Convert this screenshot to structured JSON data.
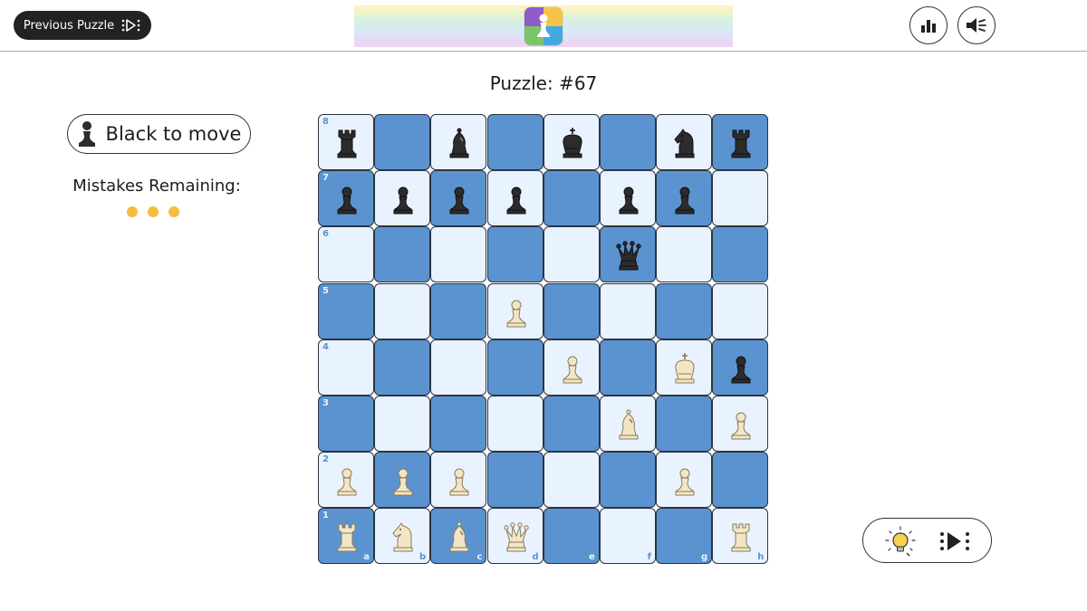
{
  "header": {
    "previous_label": "Previous Puzzle",
    "logo_stripe_colors": [
      "#faf3c5",
      "#eaf5cf",
      "#dcf2dd",
      "#d7efe9",
      "#d8ebf2",
      "#dde4f4",
      "#e4dcf4",
      "#ecd6f2"
    ],
    "logo_colors": [
      "#8f5cc9",
      "#f5c24a",
      "#43a8e0",
      "#7cc46a"
    ],
    "stats_icon": "bar-chart-icon",
    "sound_icon": "speaker-icon"
  },
  "puzzle": {
    "title": "Puzzle: #67",
    "to_move": "Black to move",
    "mistakes_label": "Mistakes Remaining:",
    "mistakes_remaining": 3
  },
  "board": {
    "colors": {
      "light": "#e9f3ff",
      "dark": "#5b93d0",
      "white_piece": "#f3e6c7",
      "black_piece": "#2c2c2c"
    },
    "ranks": [
      "8",
      "7",
      "6",
      "5",
      "4",
      "3",
      "2",
      "1"
    ],
    "files": [
      "a",
      "b",
      "c",
      "d",
      "e",
      "f",
      "g",
      "h"
    ],
    "pieces": [
      {
        "sq": "a8",
        "piece": "rook",
        "color": "black"
      },
      {
        "sq": "c8",
        "piece": "bishop",
        "color": "black"
      },
      {
        "sq": "e8",
        "piece": "king",
        "color": "black"
      },
      {
        "sq": "g8",
        "piece": "knight",
        "color": "black"
      },
      {
        "sq": "h8",
        "piece": "rook",
        "color": "black"
      },
      {
        "sq": "a7",
        "piece": "pawn",
        "color": "black"
      },
      {
        "sq": "b7",
        "piece": "pawn",
        "color": "black"
      },
      {
        "sq": "c7",
        "piece": "pawn",
        "color": "black"
      },
      {
        "sq": "d7",
        "piece": "pawn",
        "color": "black"
      },
      {
        "sq": "f7",
        "piece": "pawn",
        "color": "black"
      },
      {
        "sq": "g7",
        "piece": "pawn",
        "color": "black"
      },
      {
        "sq": "f6",
        "piece": "queen",
        "color": "black"
      },
      {
        "sq": "d5",
        "piece": "pawn",
        "color": "white"
      },
      {
        "sq": "e4",
        "piece": "pawn",
        "color": "white"
      },
      {
        "sq": "g4",
        "piece": "king",
        "color": "white"
      },
      {
        "sq": "h4",
        "piece": "pawn",
        "color": "black"
      },
      {
        "sq": "f3",
        "piece": "bishop",
        "color": "white"
      },
      {
        "sq": "h3",
        "piece": "pawn",
        "color": "white"
      },
      {
        "sq": "a2",
        "piece": "pawn",
        "color": "white"
      },
      {
        "sq": "b2",
        "piece": "pawn",
        "color": "white"
      },
      {
        "sq": "c2",
        "piece": "pawn",
        "color": "white"
      },
      {
        "sq": "g2",
        "piece": "pawn",
        "color": "white"
      },
      {
        "sq": "a1",
        "piece": "rook",
        "color": "white"
      },
      {
        "sq": "b1",
        "piece": "knight",
        "color": "white"
      },
      {
        "sq": "c1",
        "piece": "bishop",
        "color": "white"
      },
      {
        "sq": "d1",
        "piece": "queen",
        "color": "white"
      },
      {
        "sq": "h1",
        "piece": "rook",
        "color": "white"
      }
    ]
  },
  "controls": {
    "hint_icon": "lightbulb-icon",
    "skip_icon": "skip-icon"
  }
}
